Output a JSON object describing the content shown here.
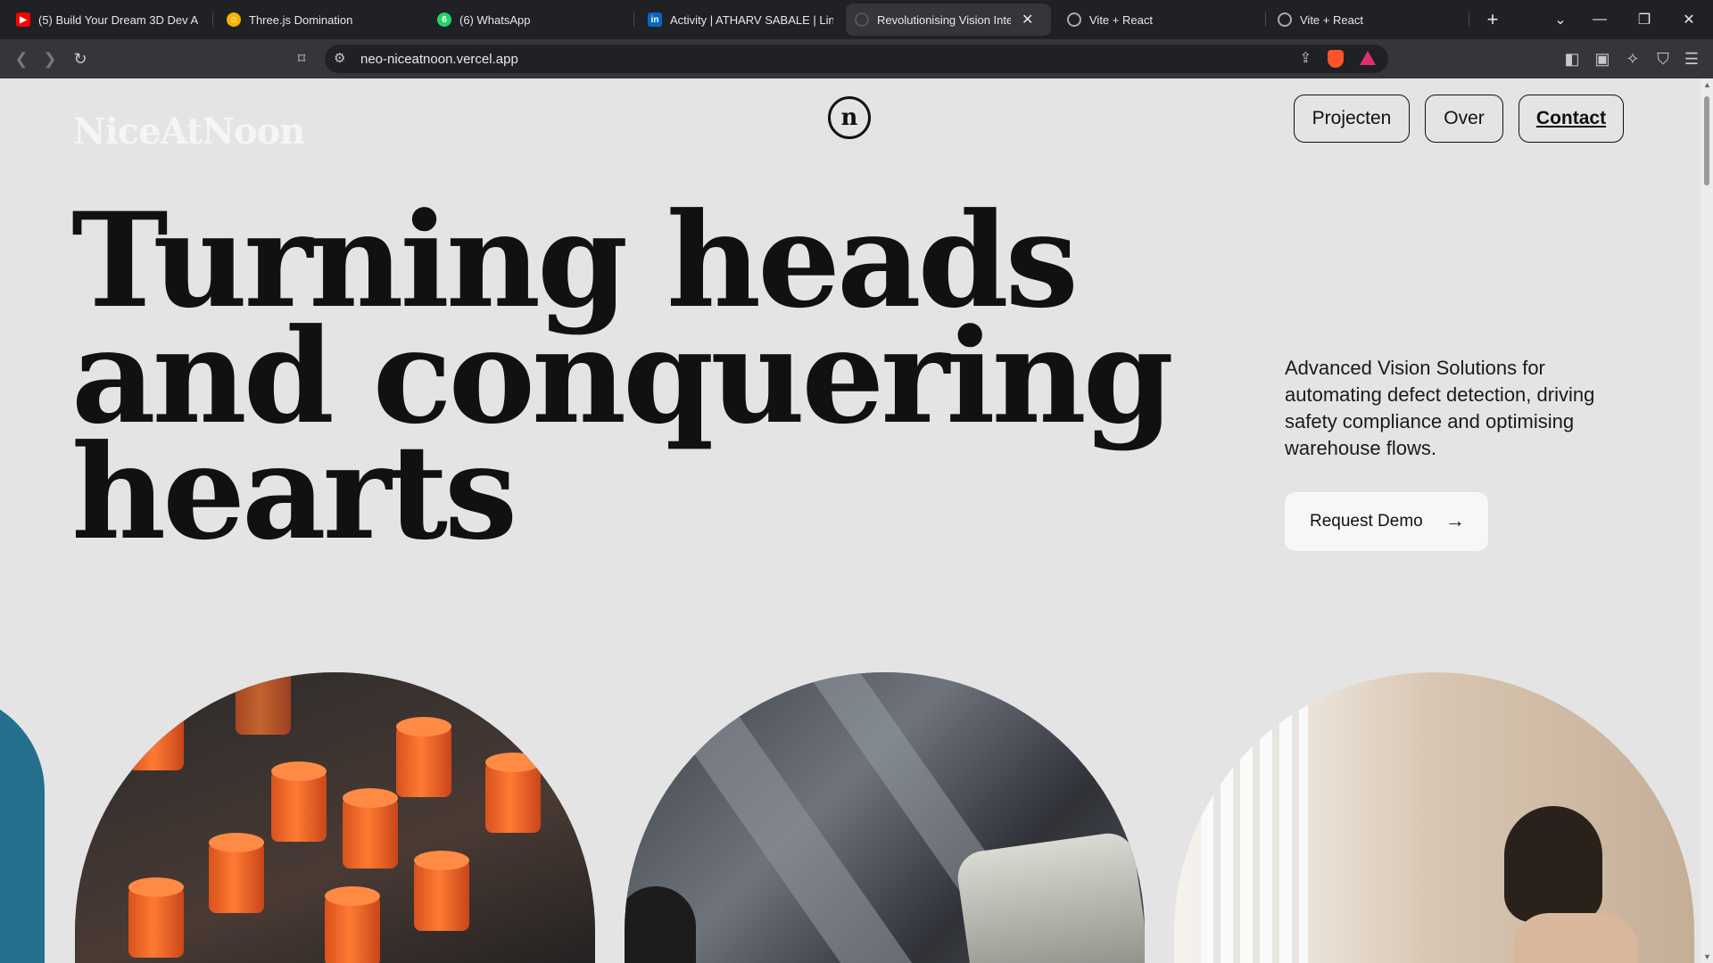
{
  "browser": {
    "tabs": [
      {
        "title": "(5) Build Your Dream 3D Dev A",
        "icon": "youtube-icon"
      },
      {
        "title": "Three.js Domination",
        "icon": "face-icon"
      },
      {
        "title": "(6) WhatsApp",
        "icon": "whatsapp-icon"
      },
      {
        "title": "Activity | ATHARV SABALE | Lin",
        "icon": "linkedin-icon"
      },
      {
        "title": "Revolutionising Vision Inte",
        "icon": "spinner-icon",
        "active": true
      },
      {
        "title": "Vite + React",
        "icon": "globe-icon"
      },
      {
        "title": "Vite + React",
        "icon": "globe-icon"
      }
    ],
    "url": "neo-niceatnoon.vercel.app"
  },
  "site": {
    "brand": "NiceAtNoon",
    "nav": [
      "Projecten",
      "Over",
      "Contact"
    ],
    "headline": [
      "Turning heads",
      "and conquering",
      "hearts"
    ],
    "description": "Advanced Vision Solutions for automating defect detection, driving safety compliance and optimising warehouse flows.",
    "cta": "Request Demo"
  },
  "colors": {
    "page_bg": "#e4e4e4",
    "text": "#111111",
    "accent_orange": "#ff6a24",
    "accent_teal": "#246f8e"
  }
}
